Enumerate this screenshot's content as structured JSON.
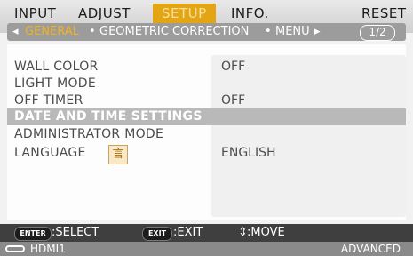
{
  "menu": {
    "tabs": [
      "INPUT",
      "ADJUST",
      "SETUP",
      "INFO.",
      "RESET"
    ],
    "active_tab": "SETUP"
  },
  "submenu": {
    "items": [
      "GENERAL",
      "GEOMETRIC CORRECTION",
      "MENU"
    ],
    "separator": "•",
    "left_arrow": "◂",
    "right_arrow": "▸",
    "active": "GENERAL",
    "page": "1/2"
  },
  "settings": {
    "rows": [
      {
        "label": "WALL COLOR",
        "value": "OFF"
      },
      {
        "label": "LIGHT MODE",
        "value": ""
      },
      {
        "label": "OFF TIMER",
        "value": "OFF"
      },
      {
        "label": "DATE AND TIME SETTINGS",
        "value": ""
      },
      {
        "label": "ADMINISTRATOR MODE",
        "value": ""
      },
      {
        "label": "LANGUAGE",
        "value": "ENGLISH"
      }
    ],
    "selected_index": 3
  },
  "hints": {
    "enter_key": "ENTER",
    "select": ":SELECT",
    "exit_key": "EXIT",
    "exit": ":EXIT",
    "move_icon": "⇕",
    "move": ":MOVE"
  },
  "footer": {
    "source": "HDMI1",
    "mode": "ADVANCED"
  },
  "colors": {
    "accent": "#e4a514",
    "selected_row": "#b9b9b9",
    "subbar": "#9c9c9c"
  }
}
